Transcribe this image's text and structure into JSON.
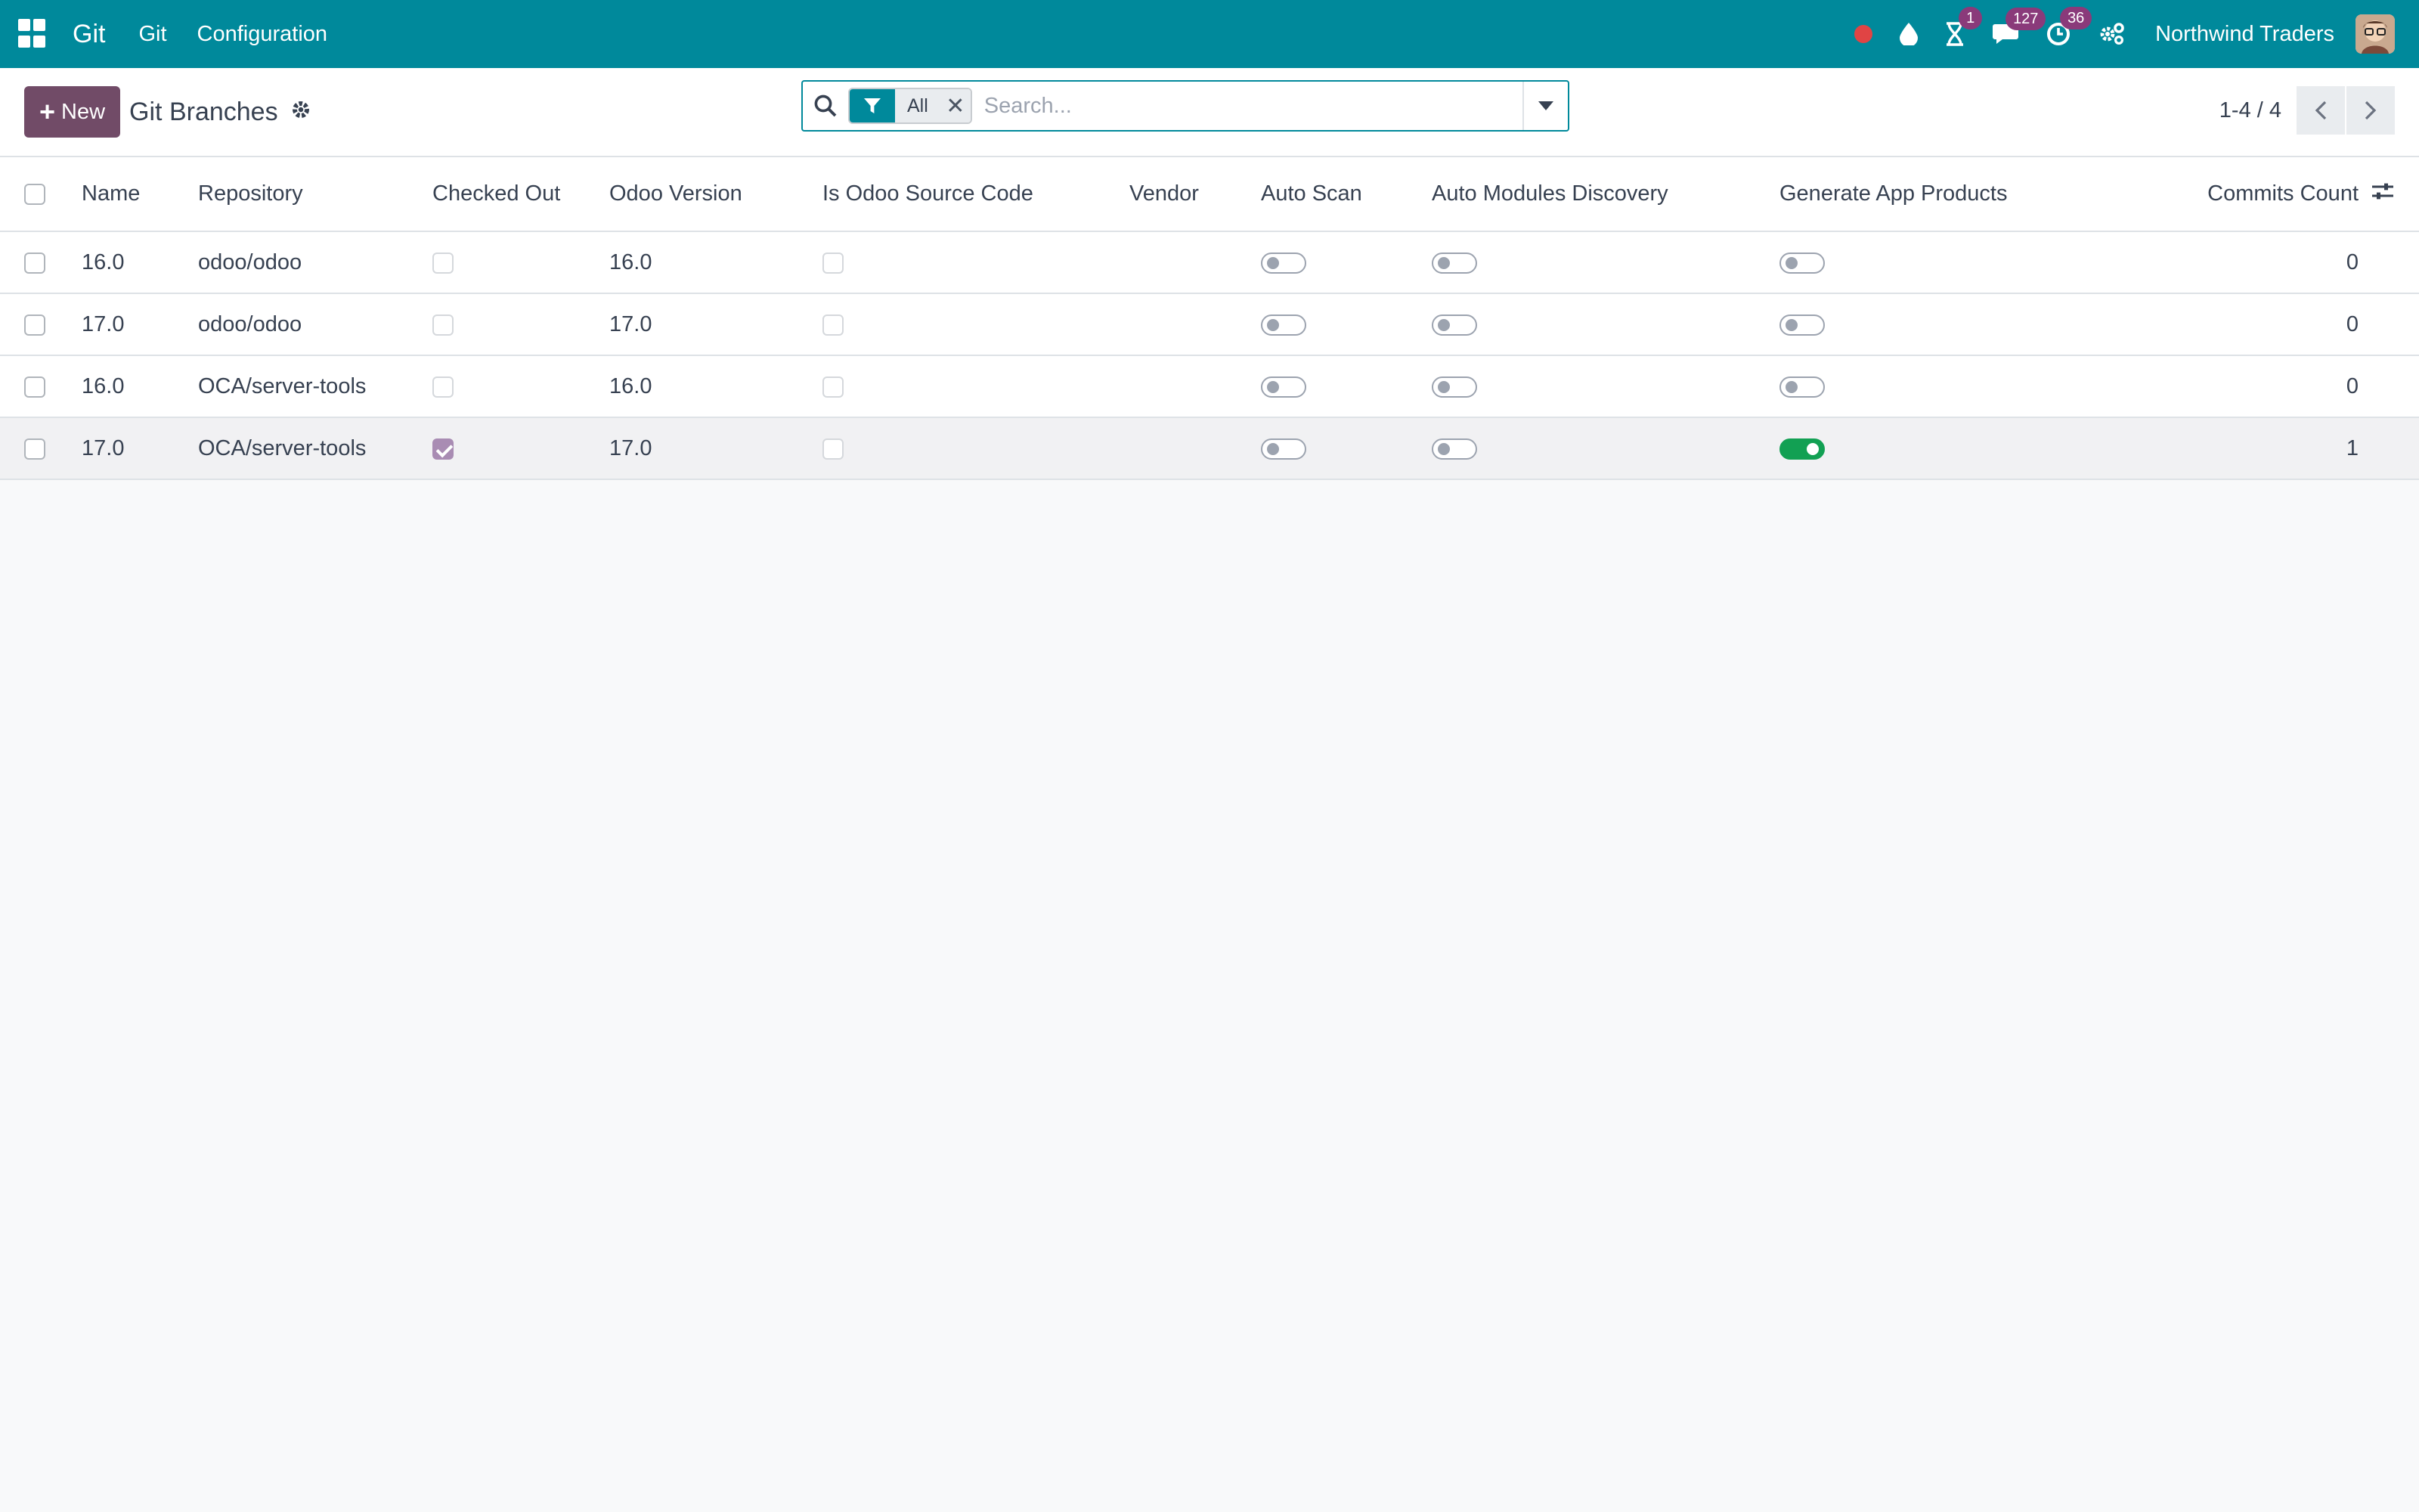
{
  "navbar": {
    "brand": "Git",
    "menus": [
      "Git",
      "Configuration"
    ],
    "badges": {
      "activities": "1",
      "messages": "127",
      "clock": "36"
    },
    "company": "Northwind Traders"
  },
  "control_panel": {
    "new_label": "New",
    "breadcrumb": "Git Branches",
    "search": {
      "facet_label": "All",
      "placeholder": "Search..."
    },
    "pager": "1-4 / 4"
  },
  "table": {
    "headers": [
      "Name",
      "Repository",
      "Checked Out",
      "Odoo Version",
      "Is Odoo Source Code",
      "Vendor",
      "Auto Scan",
      "Auto Modules Discovery",
      "Generate App Products",
      "Commits Count"
    ],
    "rows": [
      {
        "name": "16.0",
        "repository": "odoo/odoo",
        "checked_out": false,
        "odoo_version": "16.0",
        "is_odoo_source": false,
        "vendor": "",
        "auto_scan": false,
        "auto_discovery": false,
        "generate_products": false,
        "commits": "0"
      },
      {
        "name": "17.0",
        "repository": "odoo/odoo",
        "checked_out": false,
        "odoo_version": "17.0",
        "is_odoo_source": false,
        "vendor": "",
        "auto_scan": false,
        "auto_discovery": false,
        "generate_products": false,
        "commits": "0"
      },
      {
        "name": "16.0",
        "repository": "OCA/server-tools",
        "checked_out": false,
        "odoo_version": "16.0",
        "is_odoo_source": false,
        "vendor": "",
        "auto_scan": false,
        "auto_discovery": false,
        "generate_products": false,
        "commits": "0"
      },
      {
        "name": "17.0",
        "repository": "OCA/server-tools",
        "checked_out": true,
        "odoo_version": "17.0",
        "is_odoo_source": false,
        "vendor": "",
        "auto_scan": false,
        "auto_discovery": false,
        "generate_products": true,
        "commits": "1"
      }
    ]
  },
  "colors": {
    "navbar": "#00899b",
    "primary": "#714b67",
    "toggle_on": "#12a053",
    "checkbox_checked": "#a98cb3"
  }
}
